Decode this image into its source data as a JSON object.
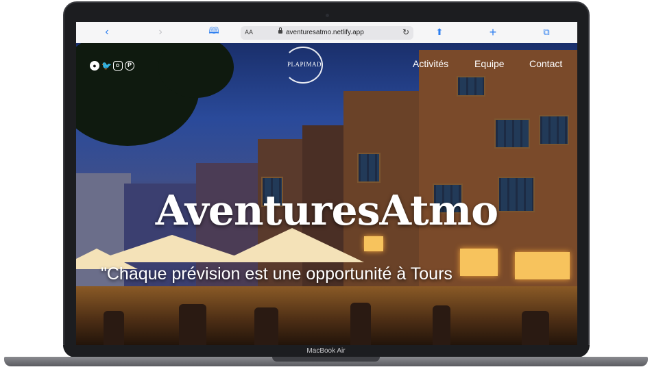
{
  "browser": {
    "url": "aventuresatmo.netlify.app",
    "text_size_label": "AA",
    "icons": [
      "chevron-left-icon",
      "chevron-right-icon",
      "book-icon",
      "reload-icon",
      "share-icon",
      "plus-icon",
      "tabs-icon"
    ]
  },
  "site": {
    "social_icons": [
      "github-icon",
      "twitter-icon",
      "instagram-icon",
      "pinterest-icon"
    ],
    "logo_text": "PLAPIMAD",
    "nav": [
      "Activités",
      "Equipe",
      "Contact"
    ],
    "hero_title": "AventuresAtmo",
    "hero_quote": "\"Chaque prévision est une opportunité à Tours"
  },
  "device": {
    "label": "MacBook Air"
  }
}
